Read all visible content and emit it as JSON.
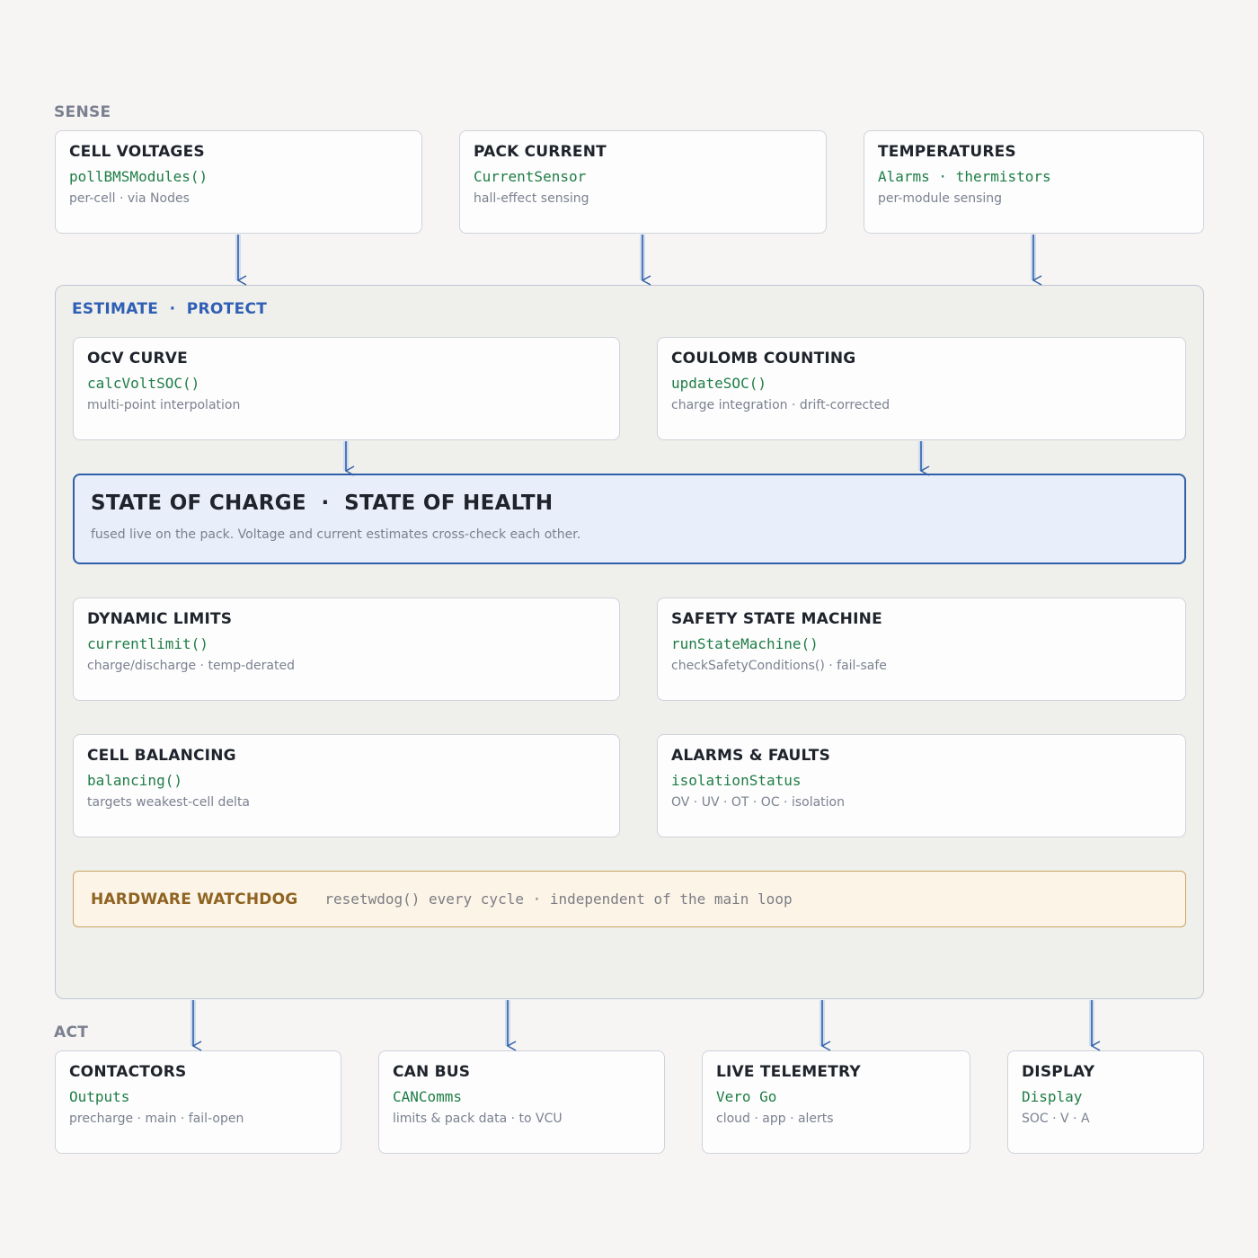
{
  "sense": {
    "label": "SENSE",
    "boxes": [
      {
        "title": "CELL VOLTAGES",
        "code": "pollBMSModules()",
        "desc": "per-cell · via Nodes"
      },
      {
        "title": "PACK CURRENT",
        "code": "CurrentSensor",
        "desc": "hall-effect sensing"
      },
      {
        "title": "TEMPERATURES",
        "code": "Alarms · thermistors",
        "desc": "per-module sensing"
      }
    ]
  },
  "core": {
    "label": "ESTIMATE  ·  PROTECT",
    "ocv": {
      "title": "OCV CURVE",
      "code": "calcVoltSOC()",
      "desc": "multi-point interpolation"
    },
    "coulomb": {
      "title": "COULOMB COUNTING",
      "code": "updateSOC()",
      "desc": "charge integration · drift-corrected"
    },
    "soc": {
      "title": "STATE OF CHARGE  ·  STATE OF HEALTH",
      "desc": "fused live on the pack. Voltage and current estimates cross-check each other."
    },
    "limits": {
      "title": "DYNAMIC LIMITS",
      "code": "currentlimit()",
      "desc": "charge/discharge · temp-derated"
    },
    "safety": {
      "title": "SAFETY STATE MACHINE",
      "code": "runStateMachine()",
      "desc": "checkSafetyConditions() · fail-safe"
    },
    "balancing": {
      "title": "CELL BALANCING",
      "code": "balancing()",
      "desc": "targets weakest-cell delta"
    },
    "alarms": {
      "title": "ALARMS & FAULTS",
      "code": "isolationStatus",
      "desc": "OV · UV · OT · OC · isolation"
    },
    "watchdog": {
      "title": "HARDWARE WATCHDOG",
      "desc": "resetwdog() every cycle · independent of the main loop"
    }
  },
  "act": {
    "label": "ACT",
    "boxes": [
      {
        "title": "CONTACTORS",
        "code": "Outputs",
        "desc": "precharge · main · fail-open"
      },
      {
        "title": "CAN BUS",
        "code": "CANComms",
        "desc": "limits & pack data · to VCU"
      },
      {
        "title": "LIVE TELEMETRY",
        "code": "Vero Go",
        "desc": "cloud · app · alerts"
      },
      {
        "title": "DISPLAY",
        "code": "Display",
        "desc": "SOC · V · A"
      }
    ]
  },
  "colors": {
    "accent_blue": "#2f5fb5",
    "code_green": "#1e7d46",
    "watchdog_gold": "#8f6322",
    "soc_fill": "#e8effa",
    "watchdog_fill": "#fcf4e6"
  }
}
